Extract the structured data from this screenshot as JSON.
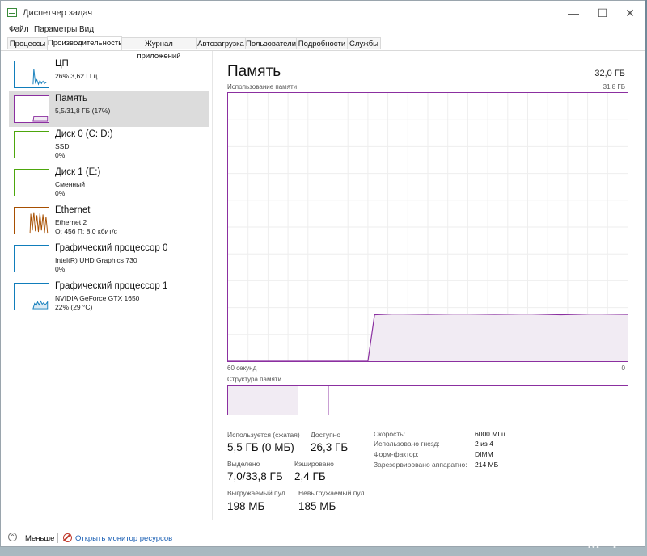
{
  "window": {
    "title": "Диспетчер задач",
    "minimize": "—",
    "maximize": "☐",
    "close": "✕"
  },
  "menu": [
    "Файл",
    "Параметры",
    "Вид"
  ],
  "tabs": [
    "Процессы",
    "Производительность",
    "Журнал приложений",
    "Автозагрузка",
    "Пользователи",
    "Подробности",
    "Службы"
  ],
  "active_tab": "Производительность",
  "sidebar": [
    {
      "name": "ЦП",
      "sub1": "26%  3,62 ГГц",
      "sub2": "",
      "color": "#117dbb",
      "icon": "cpu-graph-icon"
    },
    {
      "name": "Память",
      "sub1": "5,5/31,8 ГБ (17%)",
      "sub2": "",
      "color": "#8b2fa0",
      "icon": "memory-graph-icon"
    },
    {
      "name": "Диск 0 (C: D:)",
      "sub1": "SSD",
      "sub2": "0%",
      "color": "#4da60c",
      "icon": "disk-graph-icon"
    },
    {
      "name": "Диск 1 (E:)",
      "sub1": "Сменный",
      "sub2": "0%",
      "color": "#4da60c",
      "icon": "disk-graph-icon"
    },
    {
      "name": "Ethernet",
      "sub1": "Ethernet 2",
      "sub2": "О: 456  П: 8,0 кбит/с",
      "color": "#a74f01",
      "icon": "network-graph-icon"
    },
    {
      "name": "Графический процессор 0",
      "sub1": "Intel(R) UHD Graphics 730",
      "sub2": "0%",
      "color": "#117dbb",
      "icon": "gpu-graph-icon"
    },
    {
      "name": "Графический процессор 1",
      "sub1": "NVIDIA GeForce GTX 1650",
      "sub2": "22%  (29 °C)",
      "color": "#117dbb",
      "icon": "gpu-graph-icon"
    }
  ],
  "main": {
    "title": "Память",
    "total": "32,0 ГБ",
    "usage_label": "Использование памяти",
    "usage_max": "31,8 ГБ",
    "time_left": "60 секунд",
    "time_right": "0",
    "structure_label": "Структура памяти",
    "accent": "#8b2fa0"
  },
  "usage_graph": {
    "ylim": [
      0,
      31.8
    ],
    "x_seconds_ago": [
      60,
      40,
      39,
      38,
      35,
      30,
      25,
      20,
      15,
      10,
      5,
      0
    ],
    "y_gb": [
      0,
      0,
      0,
      5.5,
      5.6,
      5.55,
      5.6,
      5.55,
      5.6,
      5.5,
      5.6,
      5.55
    ]
  },
  "structure": {
    "in_use_pct": 17.5,
    "modified_pct": 7.5
  },
  "stats": {
    "in_use_label": "Используется (сжатая)",
    "in_use_value": "5,5 ГБ (0 МБ)",
    "available_label": "Доступно",
    "available_value": "26,3 ГБ",
    "committed_label": "Выделено",
    "committed_value": "7,0/33,8 ГБ",
    "cached_label": "Кэшировано",
    "cached_value": "2,4 ГБ",
    "paged_label": "Выгружаемый пул",
    "paged_value": "198 МБ",
    "nonpaged_label": "Невыгружаемый пул",
    "nonpaged_value": "185 МБ"
  },
  "details": [
    {
      "label": "Скорость:",
      "value": "6000 МГц"
    },
    {
      "label": "Использовано гнезд:",
      "value": "2 из 4"
    },
    {
      "label": "Форм-фактор:",
      "value": "DIMM"
    },
    {
      "label": "Зарезервировано аппаратно:",
      "value": "214 МБ"
    }
  ],
  "footer": {
    "fewer": "Меньше",
    "monitor": "Открыть монитор ресурсов"
  },
  "watermark": "M Y"
}
